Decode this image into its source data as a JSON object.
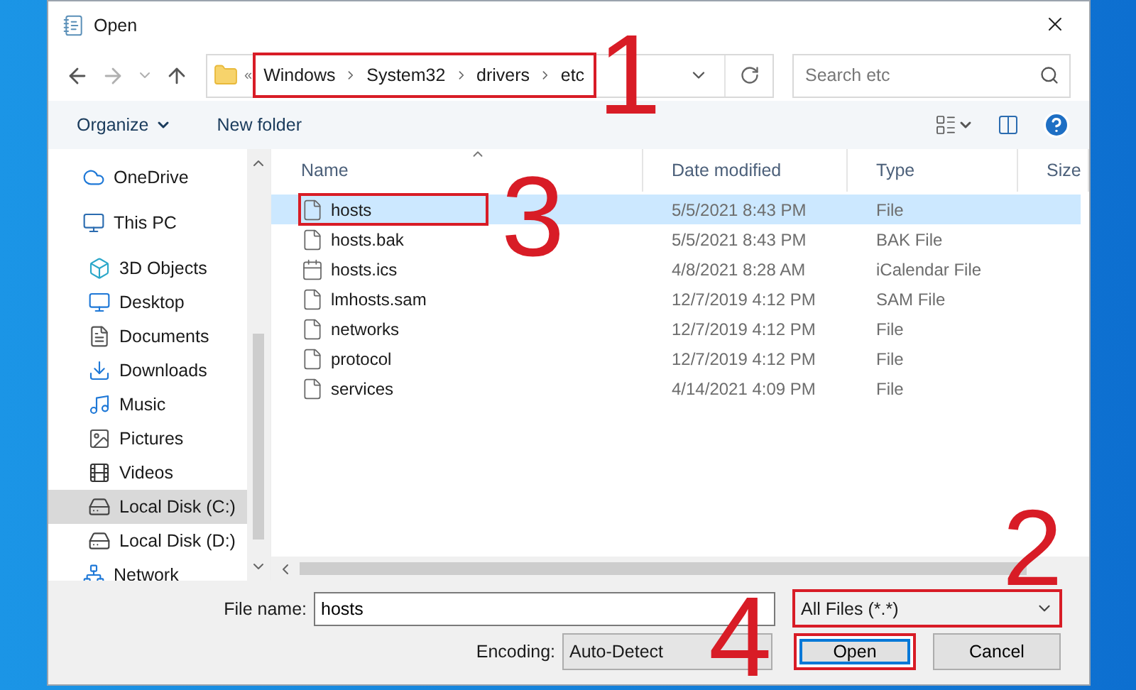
{
  "window": {
    "title": "Open"
  },
  "address": {
    "overflow": "«",
    "crumbs": [
      "Windows",
      "System32",
      "drivers",
      "etc"
    ],
    "marked": true
  },
  "search": {
    "placeholder": "Search etc"
  },
  "toolbar": {
    "organize": "Organize",
    "new_folder": "New folder"
  },
  "sidebar": {
    "items": [
      {
        "label": "OneDrive",
        "kind": "cloud",
        "selected": false
      },
      {
        "label": "This PC",
        "kind": "computer",
        "selected": false,
        "children": [
          {
            "label": "3D Objects",
            "kind": "cube",
            "selected": false
          },
          {
            "label": "Desktop",
            "kind": "desktop",
            "selected": false
          },
          {
            "label": "Documents",
            "kind": "document",
            "selected": false
          },
          {
            "label": "Downloads",
            "kind": "download",
            "selected": false
          },
          {
            "label": "Music",
            "kind": "music",
            "selected": false
          },
          {
            "label": "Pictures",
            "kind": "picture",
            "selected": false
          },
          {
            "label": "Videos",
            "kind": "video",
            "selected": false
          },
          {
            "label": "Local Disk (C:)",
            "kind": "drive",
            "selected": true
          },
          {
            "label": "Local Disk (D:)",
            "kind": "drive",
            "selected": false
          }
        ]
      },
      {
        "label": "Network",
        "kind": "network",
        "selected": false
      }
    ]
  },
  "table": {
    "columns": [
      "Name",
      "Date modified",
      "Type",
      "Size"
    ],
    "rows": [
      {
        "name": "hosts",
        "date": "5/5/2021 8:43 PM",
        "type": "File",
        "kind": "file",
        "selected": true,
        "marked": true
      },
      {
        "name": "hosts.bak",
        "date": "5/5/2021 8:43 PM",
        "type": "BAK File",
        "kind": "file",
        "selected": false,
        "marked": false
      },
      {
        "name": "hosts.ics",
        "date": "4/8/2021 8:28 AM",
        "type": "iCalendar File",
        "kind": "calendar",
        "selected": false,
        "marked": false
      },
      {
        "name": "lmhosts.sam",
        "date": "12/7/2019 4:12 PM",
        "type": "SAM File",
        "kind": "file",
        "selected": false,
        "marked": false
      },
      {
        "name": "networks",
        "date": "12/7/2019 4:12 PM",
        "type": "File",
        "kind": "file",
        "selected": false,
        "marked": false
      },
      {
        "name": "protocol",
        "date": "12/7/2019 4:12 PM",
        "type": "File",
        "kind": "file",
        "selected": false,
        "marked": false
      },
      {
        "name": "services",
        "date": "4/14/2021 4:09 PM",
        "type": "File",
        "kind": "file",
        "selected": false,
        "marked": false
      }
    ]
  },
  "footer": {
    "file_name_label": "File name:",
    "file_name": "hosts",
    "filter": "All Files  (*.*)",
    "filter_marked": true,
    "encoding_label": "Encoding:",
    "encoding": "Auto-Detect",
    "open": "Open",
    "open_marked": true,
    "cancel": "Cancel"
  },
  "annotations": [
    {
      "text": "1"
    },
    {
      "text": "3"
    },
    {
      "text": "2"
    },
    {
      "text": "4"
    }
  ]
}
